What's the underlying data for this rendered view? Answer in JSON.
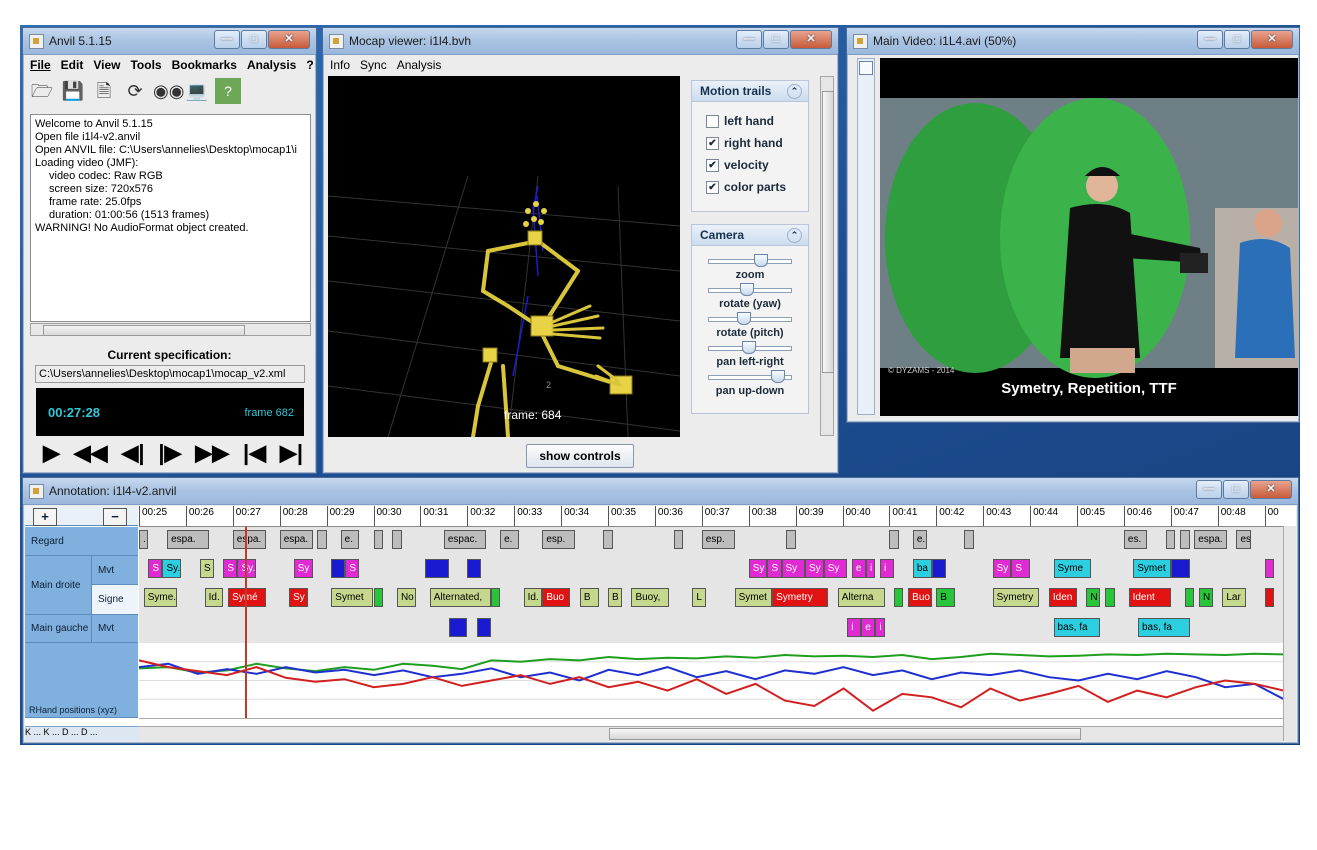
{
  "anvil": {
    "title": "Anvil 5.1.15",
    "menu": [
      "File",
      "Edit",
      "View",
      "Tools",
      "Bookmarks",
      "Analysis",
      "?"
    ],
    "toolbar_icons": [
      "open-folder-icon",
      "save-disk-icon",
      "new-document-icon",
      "refresh-icon",
      "binoculars-icon",
      "monitor-icon",
      "help-icon"
    ],
    "log": [
      {
        "text": "Welcome to Anvil 5.1.15",
        "indent": false
      },
      {
        "text": "Open file i1l4-v2.anvil",
        "indent": false
      },
      {
        "text": "Open ANVIL file: C:\\Users\\annelies\\Desktop\\mocap1\\i",
        "indent": false
      },
      {
        "text": "Loading video (JMF):",
        "indent": false
      },
      {
        "text": "video codec: Raw RGB",
        "indent": true
      },
      {
        "text": "screen size: 720x576",
        "indent": true
      },
      {
        "text": "frame rate: 25.0fps",
        "indent": true
      },
      {
        "text": "duration: 01:00:56 (1513 frames)",
        "indent": true
      },
      {
        "text": "WARNING! No AudioFormat object created.",
        "indent": false
      }
    ],
    "spec_title": "Current specification:",
    "spec_path": "C:\\Users\\annelies\\Desktop\\mocap1\\mocap_v2.xml",
    "time": "00:27:28",
    "frame": "frame 682"
  },
  "mocap": {
    "title": "Mocap viewer: i1l4.bvh",
    "menu": [
      "Info",
      "Sync",
      "Analysis"
    ],
    "frame_label": "frame: 684",
    "motion_trails": {
      "header": "Motion trails",
      "options": [
        {
          "label": "left hand",
          "checked": false
        },
        {
          "label": "right hand",
          "checked": true
        },
        {
          "label": "velocity",
          "checked": true
        },
        {
          "label": "color parts",
          "checked": true
        }
      ]
    },
    "camera": {
      "header": "Camera",
      "sliders": [
        {
          "label": "zoom",
          "value": 0.62
        },
        {
          "label": "rotate (yaw)",
          "value": 0.45
        },
        {
          "label": "rotate (pitch)",
          "value": 0.42
        },
        {
          "label": "pan left-right",
          "value": 0.48
        },
        {
          "label": "pan up-down",
          "value": 0.82
        }
      ]
    },
    "show_controls": "show controls"
  },
  "video": {
    "title": "Main Video: i1L4.avi (50%)",
    "subtitle": "Symetry, Repetition, TTF",
    "watermark": "© DYZAMS - 2014"
  },
  "annotation": {
    "title": "Annotation: i1l4-v2.anvil",
    "zoom_in": "+",
    "zoom_out": "−",
    "ticks": [
      "00:25",
      "00:26",
      "00:27",
      "00:28",
      "00:29",
      "00:30",
      "00:31",
      "00:32",
      "00:33",
      "00:34",
      "00:35",
      "00:36",
      "00:37",
      "00:38",
      "00:39",
      "00:40",
      "00:41",
      "00:42",
      "00:43",
      "00:44",
      "00:45",
      "00:46",
      "00:47",
      "00:48",
      "00"
    ],
    "labels": {
      "regard": "Regard",
      "main_droite": "Main droite",
      "mvt": "Mvt",
      "signe": "Signe",
      "main_gauche": "Main gauche",
      "mvt2": "Mvt",
      "graph": "RHand positions (xyz)"
    },
    "nav": "K ... K ... D ... D ...",
    "tracks": {
      "regard": [
        {
          "s": 25.0,
          "e": 25.2,
          "c": "grey",
          "t": "."
        },
        {
          "s": 25.6,
          "e": 26.5,
          "c": "grey",
          "t": "espa."
        },
        {
          "s": 27.0,
          "e": 27.7,
          "c": "grey",
          "t": "espa."
        },
        {
          "s": 28.0,
          "e": 28.7,
          "c": "grey",
          "t": "espa."
        },
        {
          "s": 28.8,
          "e": 29.0,
          "c": "grey",
          "t": ""
        },
        {
          "s": 29.3,
          "e": 29.7,
          "c": "grey",
          "t": "e."
        },
        {
          "s": 30.0,
          "e": 30.2,
          "c": "grey",
          "t": ""
        },
        {
          "s": 30.4,
          "e": 30.6,
          "c": "grey",
          "t": ""
        },
        {
          "s": 31.5,
          "e": 32.4,
          "c": "grey",
          "t": "espac."
        },
        {
          "s": 32.7,
          "e": 33.1,
          "c": "grey",
          "t": "e."
        },
        {
          "s": 33.6,
          "e": 34.3,
          "c": "grey",
          "t": "esp."
        },
        {
          "s": 34.9,
          "e": 35.1,
          "c": "grey",
          "t": ""
        },
        {
          "s": 36.4,
          "e": 36.6,
          "c": "grey",
          "t": ""
        },
        {
          "s": 37.0,
          "e": 37.7,
          "c": "grey",
          "t": "esp."
        },
        {
          "s": 38.8,
          "e": 39.0,
          "c": "grey",
          "t": ""
        },
        {
          "s": 41.0,
          "e": 41.2,
          "c": "grey",
          "t": ""
        },
        {
          "s": 41.5,
          "e": 41.8,
          "c": "grey",
          "t": "e."
        },
        {
          "s": 42.6,
          "e": 42.8,
          "c": "grey",
          "t": ""
        },
        {
          "s": 46.0,
          "e": 46.5,
          "c": "grey",
          "t": "es."
        },
        {
          "s": 46.9,
          "e": 47.1,
          "c": "grey",
          "t": ""
        },
        {
          "s": 47.2,
          "e": 47.4,
          "c": "grey",
          "t": ""
        },
        {
          "s": 47.5,
          "e": 48.2,
          "c": "grey",
          "t": "espa."
        },
        {
          "s": 48.4,
          "e": 48.7,
          "c": "grey",
          "t": "es"
        }
      ],
      "mvt": [
        {
          "s": 25.2,
          "e": 25.5,
          "c": "mag",
          "t": "S"
        },
        {
          "s": 25.5,
          "e": 25.9,
          "c": "cyan",
          "t": "Sy."
        },
        {
          "s": 26.3,
          "e": 26.6,
          "c": "olive",
          "t": "S"
        },
        {
          "s": 26.8,
          "e": 27.1,
          "c": "mag",
          "t": "S"
        },
        {
          "s": 27.1,
          "e": 27.5,
          "c": "mag",
          "t": "Sy."
        },
        {
          "s": 28.3,
          "e": 28.7,
          "c": "mag",
          "t": "Sy"
        },
        {
          "s": 29.1,
          "e": 29.4,
          "c": "blue",
          "t": ""
        },
        {
          "s": 29.4,
          "e": 29.7,
          "c": "mag",
          "t": "S"
        },
        {
          "s": 31.1,
          "e": 31.6,
          "c": "blue",
          "t": ""
        },
        {
          "s": 32.0,
          "e": 32.3,
          "c": "blue",
          "t": ""
        },
        {
          "s": 38.0,
          "e": 38.4,
          "c": "mag",
          "t": "Sy"
        },
        {
          "s": 38.4,
          "e": 38.7,
          "c": "mag",
          "t": "S"
        },
        {
          "s": 38.7,
          "e": 39.2,
          "c": "mag",
          "t": "Sy"
        },
        {
          "s": 39.2,
          "e": 39.6,
          "c": "mag",
          "t": "Sy"
        },
        {
          "s": 39.6,
          "e": 40.1,
          "c": "mag",
          "t": "Sy"
        },
        {
          "s": 40.2,
          "e": 40.5,
          "c": "mag",
          "t": "e"
        },
        {
          "s": 40.5,
          "e": 40.7,
          "c": "mag",
          "t": "i"
        },
        {
          "s": 40.8,
          "e": 41.1,
          "c": "mag",
          "t": "i"
        },
        {
          "s": 41.5,
          "e": 41.9,
          "c": "cyan",
          "t": "ba"
        },
        {
          "s": 41.9,
          "e": 42.2,
          "c": "blue",
          "t": ""
        },
        {
          "s": 43.2,
          "e": 43.6,
          "c": "mag",
          "t": "Sy"
        },
        {
          "s": 43.6,
          "e": 44.0,
          "c": "mag",
          "t": "S"
        },
        {
          "s": 44.5,
          "e": 45.3,
          "c": "cyan",
          "t": "Syme"
        },
        {
          "s": 46.2,
          "e": 47.0,
          "c": "cyan",
          "t": "Symet"
        },
        {
          "s": 47.0,
          "e": 47.4,
          "c": "blue",
          "t": ""
        },
        {
          "s": 49.0,
          "e": 49.2,
          "c": "mag",
          "t": ""
        }
      ],
      "signe": [
        {
          "s": 25.1,
          "e": 25.8,
          "c": "olive",
          "t": "Syme.."
        },
        {
          "s": 26.4,
          "e": 26.8,
          "c": "olive",
          "t": "Id."
        },
        {
          "s": 26.9,
          "e": 27.7,
          "c": "red",
          "t": "Symé"
        },
        {
          "s": 28.2,
          "e": 28.6,
          "c": "red",
          "t": "Sy"
        },
        {
          "s": 29.1,
          "e": 30.0,
          "c": "olive",
          "t": "Symet"
        },
        {
          "s": 30.0,
          "e": 30.2,
          "c": "green",
          "t": ""
        },
        {
          "s": 30.5,
          "e": 30.9,
          "c": "olive",
          "t": "No"
        },
        {
          "s": 31.2,
          "e": 32.5,
          "c": "olive",
          "t": "Alternated,"
        },
        {
          "s": 32.5,
          "e": 32.7,
          "c": "green",
          "t": ""
        },
        {
          "s": 33.2,
          "e": 33.6,
          "c": "olive",
          "t": "Id."
        },
        {
          "s": 33.6,
          "e": 34.2,
          "c": "red",
          "t": "Buo"
        },
        {
          "s": 34.4,
          "e": 34.8,
          "c": "olive",
          "t": "B"
        },
        {
          "s": 35.0,
          "e": 35.3,
          "c": "olive",
          "t": "B"
        },
        {
          "s": 35.5,
          "e": 36.3,
          "c": "olive",
          "t": "Buoy,"
        },
        {
          "s": 36.8,
          "e": 37.1,
          "c": "olive",
          "t": "L"
        },
        {
          "s": 37.7,
          "e": 38.5,
          "c": "olive",
          "t": "Symet"
        },
        {
          "s": 38.5,
          "e": 39.7,
          "c": "red",
          "t": "Symetry"
        },
        {
          "s": 39.9,
          "e": 40.9,
          "c": "olive",
          "t": "Alterna"
        },
        {
          "s": 41.1,
          "e": 41.3,
          "c": "green",
          "t": ""
        },
        {
          "s": 41.4,
          "e": 41.9,
          "c": "red",
          "t": "Buo"
        },
        {
          "s": 42.0,
          "e": 42.4,
          "c": "green",
          "t": "B"
        },
        {
          "s": 43.2,
          "e": 44.2,
          "c": "olive",
          "t": "Symetry"
        },
        {
          "s": 44.4,
          "e": 45.0,
          "c": "red",
          "t": "Iden"
        },
        {
          "s": 45.2,
          "e": 45.5,
          "c": "green",
          "t": "N"
        },
        {
          "s": 45.6,
          "e": 45.8,
          "c": "green",
          "t": ""
        },
        {
          "s": 46.1,
          "e": 47.0,
          "c": "red",
          "t": "Ident"
        },
        {
          "s": 47.3,
          "e": 47.5,
          "c": "green",
          "t": ""
        },
        {
          "s": 47.6,
          "e": 47.9,
          "c": "green",
          "t": "N"
        },
        {
          "s": 48.1,
          "e": 48.6,
          "c": "olive",
          "t": "Lar"
        },
        {
          "s": 49.0,
          "e": 49.2,
          "c": "red",
          "t": ""
        }
      ],
      "mvt2": [
        {
          "s": 31.6,
          "e": 32.0,
          "c": "blue",
          "t": ""
        },
        {
          "s": 32.2,
          "e": 32.5,
          "c": "blue",
          "t": ""
        },
        {
          "s": 40.1,
          "e": 40.4,
          "c": "mag",
          "t": "i"
        },
        {
          "s": 40.4,
          "e": 40.7,
          "c": "mag",
          "t": "e"
        },
        {
          "s": 40.7,
          "e": 40.9,
          "c": "mag",
          "t": "i"
        },
        {
          "s": 44.5,
          "e": 45.5,
          "c": "cyan",
          "t": "bas, fa"
        },
        {
          "s": 46.3,
          "e": 47.4,
          "c": "cyan",
          "t": "bas, fa"
        }
      ]
    },
    "playhead": 27.25,
    "graph_series": [
      {
        "color": "#1f9e1f",
        "values": [
          0.32,
          0.3,
          0.38,
          0.35,
          0.25,
          0.32,
          0.36,
          0.3,
          0.34,
          0.25,
          0.28,
          0.33,
          0.2,
          0.22,
          0.18,
          0.2,
          0.15,
          0.18,
          0.16,
          0.17,
          0.14,
          0.16,
          0.12,
          0.14,
          0.13,
          0.15,
          0.12,
          0.18,
          0.15,
          0.1,
          0.12,
          0.14,
          0.13,
          0.11,
          0.12,
          0.1,
          0.11,
          0.12,
          0.1,
          0.11
        ]
      },
      {
        "color": "#1f2fd0",
        "values": [
          0.3,
          0.25,
          0.4,
          0.33,
          0.4,
          0.3,
          0.38,
          0.34,
          0.42,
          0.35,
          0.45,
          0.4,
          0.32,
          0.45,
          0.38,
          0.5,
          0.34,
          0.42,
          0.3,
          0.45,
          0.36,
          0.48,
          0.35,
          0.4,
          0.3,
          0.42,
          0.35,
          0.48,
          0.38,
          0.42,
          0.35,
          0.45,
          0.5,
          0.4,
          0.48,
          0.36,
          0.45,
          0.6,
          0.55,
          0.78
        ]
      },
      {
        "color": "#d21f1f",
        "values": [
          0.2,
          0.3,
          0.36,
          0.42,
          0.3,
          0.46,
          0.52,
          0.48,
          0.6,
          0.55,
          0.45,
          0.58,
          0.5,
          0.42,
          0.55,
          0.45,
          0.6,
          0.52,
          0.65,
          0.48,
          0.7,
          0.55,
          0.8,
          0.88,
          0.62,
          0.95,
          0.7,
          0.75,
          0.9,
          0.62,
          0.8,
          0.7,
          0.58,
          0.82,
          0.65,
          0.75,
          0.6,
          0.5,
          0.55,
          0.65
        ]
      }
    ]
  }
}
